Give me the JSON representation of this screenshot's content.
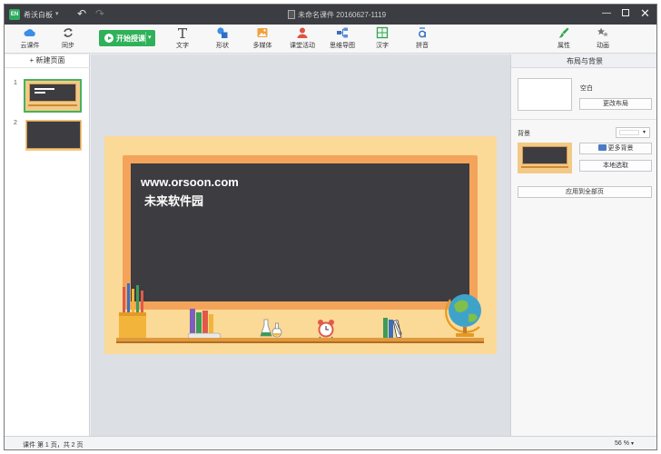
{
  "titlebar": {
    "logo_text": "EN",
    "app_name": "希沃白板",
    "doc_title": "未命名课件 20160627-1119"
  },
  "toolbar": {
    "cloud_label": "云课件",
    "sync_label": "同步",
    "start_label": "开始授课",
    "tools": [
      {
        "label": "文字",
        "icon": "text-icon"
      },
      {
        "label": "形状",
        "icon": "shape-icon"
      },
      {
        "label": "多媒体",
        "icon": "media-icon"
      },
      {
        "label": "课堂活动",
        "icon": "classroom-activity-icon"
      },
      {
        "label": "思维导图",
        "icon": "mindmap-icon"
      },
      {
        "label": "汉字",
        "icon": "hanzi-icon"
      },
      {
        "label": "拼音",
        "icon": "pinyin-icon"
      }
    ],
    "properties_label": "属性",
    "animation_label": "动画"
  },
  "left_panel": {
    "new_page_label": "+ 新建页面",
    "pages": [
      {
        "number": "1",
        "selected": true
      },
      {
        "number": "2",
        "selected": false
      }
    ]
  },
  "slide": {
    "line1": "www.orsoon.com",
    "line2": "未来软件园"
  },
  "right_panel": {
    "title": "布局与背景",
    "layout_name": "空白",
    "change_layout_label": "更改布局",
    "background_label": "背景",
    "background_color": "#ffffff",
    "more_backgrounds_label": "更多背景",
    "local_select_label": "本地选取",
    "apply_all_label": "应用到全部页"
  },
  "statusbar": {
    "page_info": "课件 第 1 页，共 2 页",
    "zoom": "56 %"
  },
  "colors": {
    "accent_green": "#2fb15a",
    "chalkboard": "#3c3c41",
    "slide_bg": "#fbd997",
    "titlebar": "#3b3d42"
  }
}
